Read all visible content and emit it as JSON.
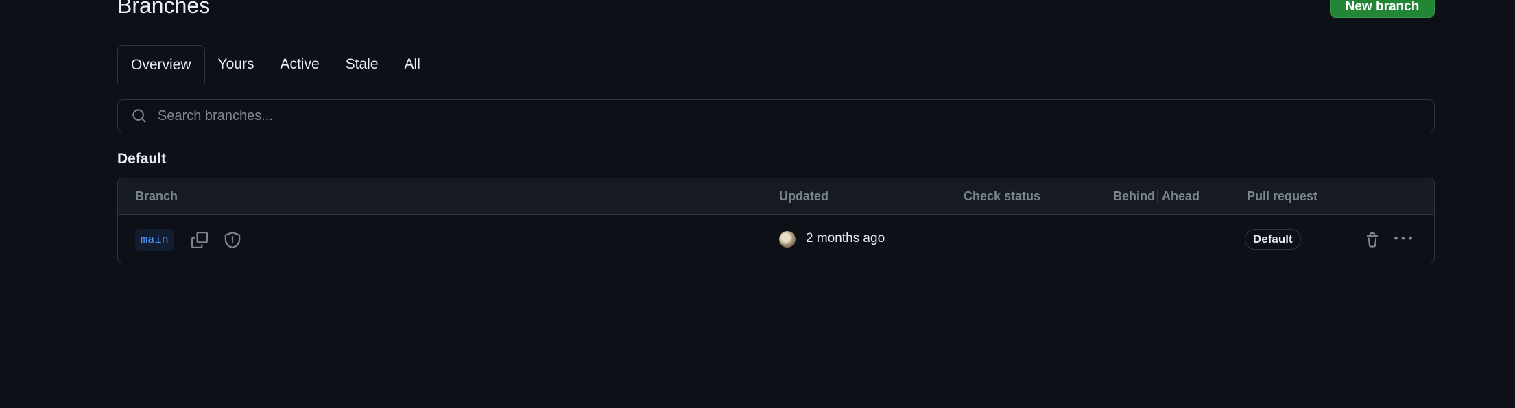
{
  "header": {
    "title": "Branches",
    "new_branch_label": "New branch"
  },
  "tabs": [
    {
      "label": "Overview",
      "selected": true
    },
    {
      "label": "Yours",
      "selected": false
    },
    {
      "label": "Active",
      "selected": false
    },
    {
      "label": "Stale",
      "selected": false
    },
    {
      "label": "All",
      "selected": false
    }
  ],
  "search": {
    "placeholder": "Search branches..."
  },
  "section": {
    "title": "Default"
  },
  "table": {
    "columns": {
      "branch": "Branch",
      "updated": "Updated",
      "check_status": "Check status",
      "behind": "Behind",
      "ahead": "Ahead",
      "pull_request": "Pull request"
    },
    "rows": [
      {
        "branch": "main",
        "updated": "2 months ago",
        "badge": "Default",
        "icons": [
          "copy-icon",
          "shield-icon",
          "trash-icon",
          "kebab-icon"
        ]
      }
    ]
  },
  "colors": {
    "background": "#0d1117",
    "border": "#30363d",
    "primary_button": "#238636",
    "link": "#4493f8",
    "muted": "#7d8590"
  }
}
